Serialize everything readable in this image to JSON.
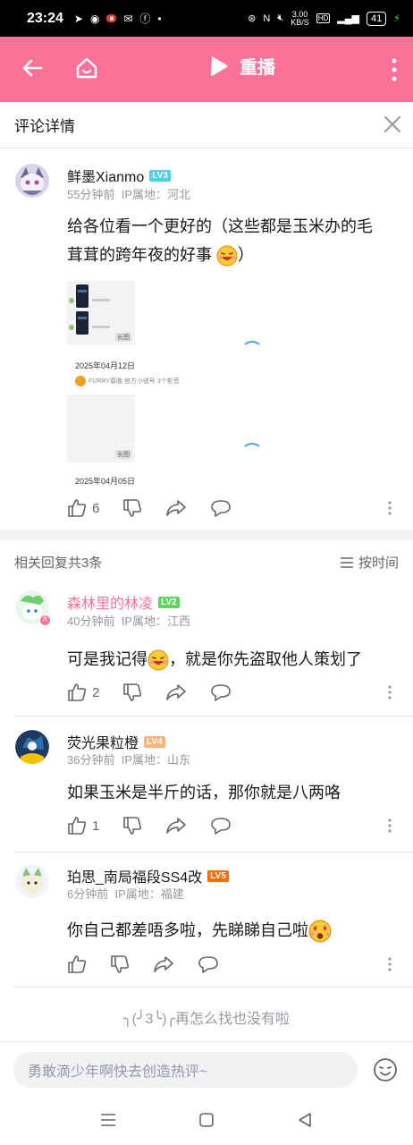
{
  "status": {
    "time": "23:24",
    "speed_top": "3.00",
    "speed_bottom": "KB/S",
    "hd": "HD",
    "battery": "41"
  },
  "topbar": {
    "replay_label": "重播"
  },
  "detail": {
    "title": "评论详情"
  },
  "main_comment": {
    "user": "鲜墨Xianmo",
    "level": "LV3",
    "level_color": "#4bd2e7",
    "time": "55分钟前",
    "ip": "IP属地：河北",
    "text_line1": "给各位看一个更好的（这些都是玉米办的毛",
    "text_line2": "茸茸的跨年夜的好事",
    "text_end": "）",
    "images": [
      {
        "date": "2025年04月12日",
        "sub": "FURRY春晚 官方小號号  3个影音",
        "tag": "长图"
      },
      {
        "date": "2025年04月05日",
        "tag": "长图"
      }
    ],
    "likes": "6"
  },
  "replies_header": {
    "count": "相关回复共3条",
    "sort": "按时间"
  },
  "replies": [
    {
      "user": "森林里的林凌",
      "user_color": "#fb7299",
      "level": "LV2",
      "level_color": "#5fd35f",
      "time": "40分钟前",
      "ip": "IP属地：江西",
      "text_before": "可是我记得",
      "text_after": "，就是你先盗取他人策划了",
      "likes": "2"
    },
    {
      "user": "荧光果粒橙",
      "user_color": "#18191c",
      "level": "LV4",
      "level_color": "#ffb37c",
      "time": "36分钟前",
      "ip": "IP属地：山东",
      "text_before": "如果玉米是半斤的话，那你就是八两咯",
      "text_after": "",
      "likes": "1"
    },
    {
      "user": "珀思_南局福段SS4改",
      "user_color": "#18191c",
      "level": "LV5",
      "level_color": "#ff6c00",
      "time": "6分钟前",
      "ip": "IP属地：福建",
      "text_before": "你自己都差唔多啦，先睇睇自己啦",
      "text_after": "",
      "likes": ""
    }
  ],
  "end_text": "╮(╯3╰)╭再怎么找也没有啦",
  "input_placeholder": "勇敢滴少年啊快去创造热评~"
}
